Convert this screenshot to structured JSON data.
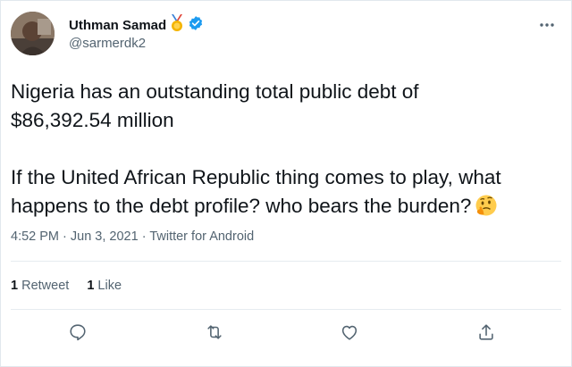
{
  "user": {
    "display_name": "Uthman Samad",
    "handle": "@sarmerdk2"
  },
  "tweet": {
    "paragraph_1_line_1": "Nigeria has an outstanding total public debt of",
    "paragraph_1_line_2": "$86,392.54 million",
    "paragraph_2_line_1": "If the United African Republic thing comes to play, what",
    "paragraph_2_line_2": "happens to the debt profile? who bears the burden?",
    "emoji": "thinking-face"
  },
  "meta": {
    "time": "4:52 PM",
    "separator_1": " · ",
    "date": "Jun 3, 2021",
    "separator_2": " · ",
    "source": "Twitter for Android"
  },
  "stats": {
    "retweet_count": "1",
    "retweet_label": " Retweet",
    "like_count": "1",
    "like_label": " Like"
  },
  "icons": {
    "reply": "reply-icon",
    "retweet": "retweet-icon",
    "like": "like-icon",
    "share": "share-icon",
    "more": "more-icon",
    "medal": "medal-icon",
    "verified": "verified-badge-icon"
  },
  "colors": {
    "verified_blue": "#1d9bf0",
    "medal_gold": "#f4b400",
    "secondary_text": "#536471",
    "primary_text": "#0f1419"
  }
}
